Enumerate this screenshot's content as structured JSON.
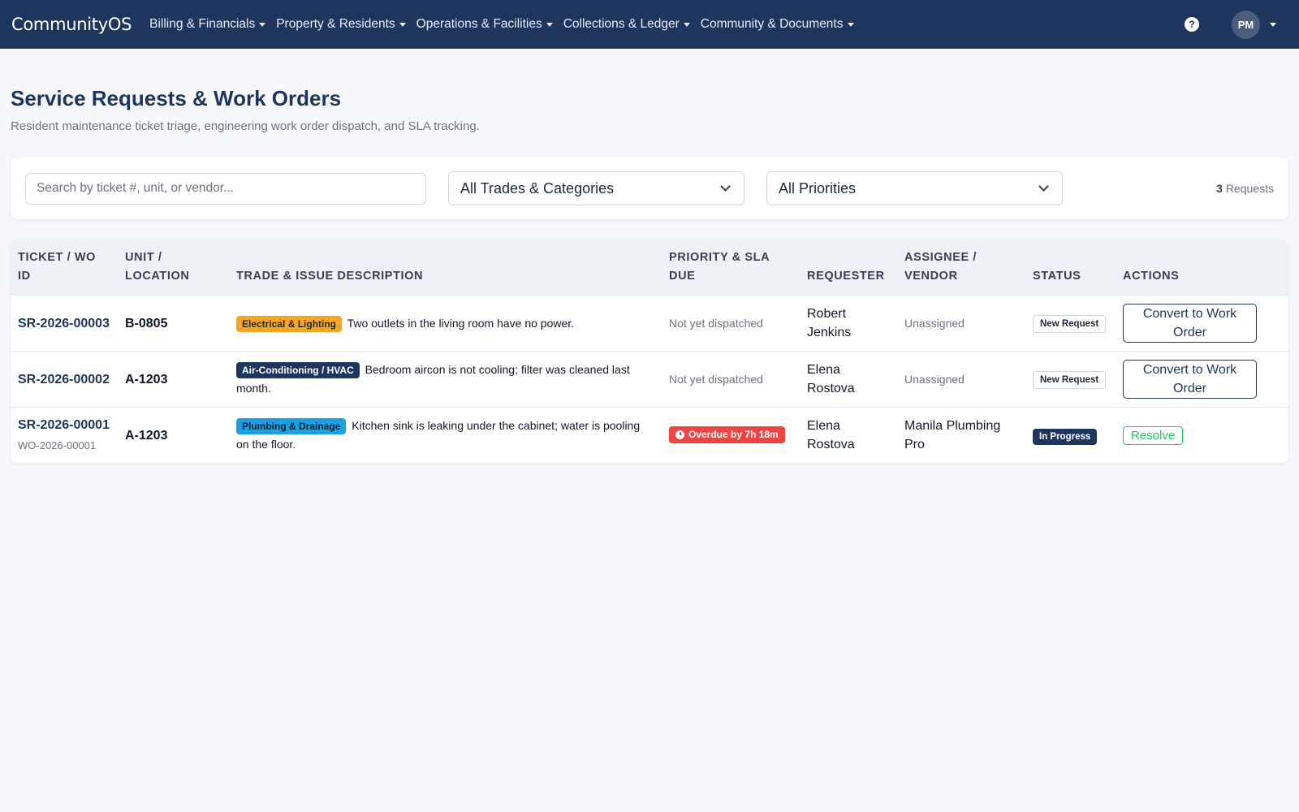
{
  "navbar": {
    "brand": "CommunityOS",
    "menu": [
      {
        "label": "Billing & Financials"
      },
      {
        "label": "Property & Residents"
      },
      {
        "label": "Operations & Facilities"
      },
      {
        "label": "Collections & Ledger"
      },
      {
        "label": "Community & Documents"
      }
    ],
    "help_glyph": "?",
    "avatar_initials": "PM",
    "icons": {
      "help": "question-circle-icon",
      "caret": "caret-down-icon"
    }
  },
  "page": {
    "title": "Service Requests & Work Orders",
    "subtitle": "Resident maintenance ticket triage, engineering work order dispatch, and SLA tracking."
  },
  "filters": {
    "search_placeholder": "Search by ticket #, unit, or vendor...",
    "search_value": "",
    "trade_selected": "All Trades & Categories",
    "priority_selected": "All Priorities",
    "count_number": "3",
    "count_label": "Requests"
  },
  "table": {
    "headers": {
      "ticket": "TICKET / WO ID",
      "unit": "UNIT / LOCATION",
      "trade": "TRADE & ISSUE DESCRIPTION",
      "priority": "PRIORITY & SLA DUE",
      "requester": "REQUESTER",
      "assignee": "ASSIGNEE / VENDOR",
      "status": "STATUS",
      "actions": "ACTIONS"
    },
    "rows": [
      {
        "ticket": "SR-2026-00003",
        "wo": "",
        "unit": "B-0805",
        "trade": "Electrical & Lighting",
        "description": "Two outlets in the living room have no power.",
        "sla": "Not yet dispatched",
        "requester": "Robert Jenkins",
        "assignee": "Unassigned",
        "status": "New Request",
        "action": "Convert to Work Order"
      },
      {
        "ticket": "SR-2026-00002",
        "wo": "",
        "unit": "A-1203",
        "trade": "Air-Conditioning / HVAC",
        "description": "Bedroom aircon is not cooling; filter was cleaned last month.",
        "sla": "Not yet dispatched",
        "requester": "Elena Rostova",
        "assignee": "Unassigned",
        "status": "New Request",
        "action": "Convert to Work Order"
      },
      {
        "ticket": "SR-2026-00001",
        "wo": "WO-2026-00001",
        "unit": "A-1203",
        "trade": "Plumbing & Drainage",
        "description": "Kitchen sink is leaking under the cabinet; water is pooling on the floor.",
        "sla": "Overdue by 7h 18m",
        "requester": "Elena Rostova",
        "assignee": "Manila Plumbing Pro",
        "status": "In Progress",
        "action": "Resolve"
      }
    ]
  },
  "colors": {
    "navbar": "#1e355e",
    "electrical": "#f5a623",
    "hvac": "#1e355e",
    "plumbing": "#1ba0e2",
    "overdue": "#ef4444",
    "resolve": "#22c55e"
  }
}
